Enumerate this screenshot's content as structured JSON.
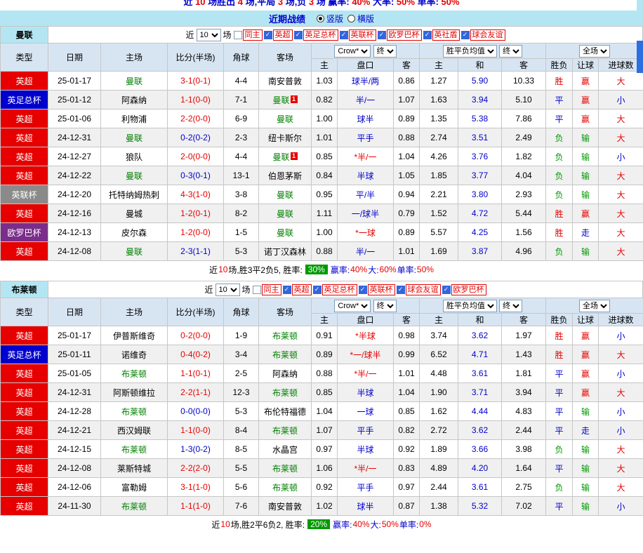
{
  "top_bar": {
    "segments": [
      {
        "t": "近 ",
        "c": "blue"
      },
      {
        "t": "10",
        "c": "red"
      },
      {
        "t": " 场胜出 ",
        "c": "blue"
      },
      {
        "t": "4",
        "c": "red"
      },
      {
        "t": " 场,平局 ",
        "c": "blue"
      },
      {
        "t": "3",
        "c": "red"
      },
      {
        "t": " 场,负 ",
        "c": "blue"
      },
      {
        "t": "3",
        "c": "red"
      },
      {
        "t": " 场 赢率: ",
        "c": "blue"
      },
      {
        "t": "40%",
        "c": "red"
      },
      {
        "t": " 大率: ",
        "c": "blue"
      },
      {
        "t": "50%",
        "c": "red"
      },
      {
        "t": " 单率: ",
        "c": "blue"
      },
      {
        "t": "50%",
        "c": "red"
      }
    ]
  },
  "title_bar": {
    "title": "近期战绩",
    "radios": [
      {
        "label": "竖版",
        "selected": true
      },
      {
        "label": "横版",
        "selected": false
      }
    ]
  },
  "colors": {
    "red": "#e60000",
    "blue": "#0000cc",
    "green": "#009900",
    "team_green": "#008000",
    "type_bg": {
      "英超": "#e60000",
      "英足总杯": "#0000cc",
      "英联杯": "#8a8a8a",
      "欧罗巴杯": "#7b2d8b"
    },
    "result": {
      "胜": "#e60000",
      "平": "#0000cc",
      "负": "#009900"
    },
    "hresult": {
      "赢": "#e60000",
      "输": "#009900",
      "走": "#0000cc"
    },
    "goals": {
      "大": "#e60000",
      "小": "#0000cc"
    }
  },
  "shared": {
    "filters": {
      "near_label": "近",
      "matches_label": "场"
    },
    "selects": {
      "recent": "10",
      "provider": "Crow*",
      "stage1": "终",
      "wdl": "胜平负均值",
      "stage2": "终",
      "scope": "全场"
    },
    "columns": {
      "type": "类型",
      "date": "日期",
      "home": "主场",
      "score": "比分(半场)",
      "corner": "角球",
      "away": "客场",
      "ah_home": "主",
      "handicap": "盘口",
      "ah_away": "客",
      "o_home": "主",
      "o_draw": "和",
      "o_away": "客",
      "wdl": "胜负",
      "hcp_res": "让球",
      "goals": "进球数"
    }
  },
  "sections": [
    {
      "team": "曼联",
      "filters": {
        "recent_value": "10",
        "checkboxes": [
          {
            "label": "同主",
            "checked": false
          },
          {
            "label": "英超",
            "checked": true
          },
          {
            "label": "英足总杯",
            "checked": true
          },
          {
            "label": "英联杯",
            "checked": true
          },
          {
            "label": "欧罗巴杯",
            "checked": true
          },
          {
            "label": "英社盾",
            "checked": true
          },
          {
            "label": "球会友谊",
            "checked": true
          }
        ]
      },
      "rows": [
        {
          "type": "英超",
          "date": "25-01-17",
          "home": "曼联",
          "hs": 1,
          "hrc": 0,
          "score": "3-1(0-1)",
          "sc": "red",
          "corner": "4-4",
          "away": "南安普敦",
          "as": 0,
          "arc": 0,
          "ah": [
            "1.03",
            "球半/两",
            "0.86"
          ],
          "odds": [
            "1.27",
            "5.90",
            "10.33"
          ],
          "res": [
            "胜",
            "赢",
            "大"
          ]
        },
        {
          "type": "英足总杯",
          "date": "25-01-12",
          "home": "阿森纳",
          "hs": 0,
          "hrc": 0,
          "score": "1-1(0-0)",
          "sc": "red",
          "corner": "7-1",
          "away": "曼联",
          "as": 1,
          "arc": 1,
          "ah": [
            "0.82",
            "半/一",
            "1.07"
          ],
          "odds": [
            "1.63",
            "3.94",
            "5.10"
          ],
          "res": [
            "平",
            "赢",
            "小"
          ]
        },
        {
          "type": "英超",
          "date": "25-01-06",
          "home": "利物浦",
          "hs": 0,
          "hrc": 0,
          "score": "2-2(0-0)",
          "sc": "red",
          "corner": "6-9",
          "away": "曼联",
          "as": 1,
          "arc": 0,
          "ah": [
            "1.00",
            "球半",
            "0.89"
          ],
          "odds": [
            "1.35",
            "5.38",
            "7.86"
          ],
          "res": [
            "平",
            "赢",
            "大"
          ]
        },
        {
          "type": "英超",
          "date": "24-12-31",
          "home": "曼联",
          "hs": 1,
          "hrc": 0,
          "score": "0-2(0-2)",
          "sc": "blue",
          "corner": "2-3",
          "away": "纽卡斯尔",
          "as": 0,
          "arc": 0,
          "ah": [
            "1.01",
            "平手",
            "0.88"
          ],
          "odds": [
            "2.74",
            "3.51",
            "2.49"
          ],
          "res": [
            "负",
            "输",
            "大"
          ]
        },
        {
          "type": "英超",
          "date": "24-12-27",
          "home": "狼队",
          "hs": 0,
          "hrc": 0,
          "score": "2-0(0-0)",
          "sc": "red",
          "corner": "4-4",
          "away": "曼联",
          "as": 1,
          "arc": 1,
          "ah": [
            "0.85",
            "*半/一",
            "1.04"
          ],
          "odds": [
            "4.26",
            "3.76",
            "1.82"
          ],
          "res": [
            "负",
            "输",
            "小"
          ]
        },
        {
          "type": "英超",
          "date": "24-12-22",
          "home": "曼联",
          "hs": 1,
          "hrc": 0,
          "score": "0-3(0-1)",
          "sc": "blue",
          "corner": "13-1",
          "away": "伯恩茅斯",
          "as": 0,
          "arc": 0,
          "ah": [
            "0.84",
            "半球",
            "1.05"
          ],
          "odds": [
            "1.85",
            "3.77",
            "4.04"
          ],
          "res": [
            "负",
            "输",
            "大"
          ]
        },
        {
          "type": "英联杯",
          "date": "24-12-20",
          "home": "托特纳姆热刺",
          "hs": 0,
          "hrc": 0,
          "score": "4-3(1-0)",
          "sc": "red",
          "corner": "3-8",
          "away": "曼联",
          "as": 1,
          "arc": 0,
          "ah": [
            "0.95",
            "平/半",
            "0.94"
          ],
          "odds": [
            "2.21",
            "3.80",
            "2.93"
          ],
          "res": [
            "负",
            "输",
            "大"
          ]
        },
        {
          "type": "英超",
          "date": "24-12-16",
          "home": "曼城",
          "hs": 0,
          "hrc": 0,
          "score": "1-2(0-1)",
          "sc": "red",
          "corner": "8-2",
          "away": "曼联",
          "as": 1,
          "arc": 0,
          "ah": [
            "1.11",
            "一/球半",
            "0.79"
          ],
          "odds": [
            "1.52",
            "4.72",
            "5.44"
          ],
          "res": [
            "胜",
            "赢",
            "大"
          ]
        },
        {
          "type": "欧罗巴杯",
          "date": "24-12-13",
          "home": "皮尔森",
          "hs": 0,
          "hrc": 0,
          "score": "1-2(0-0)",
          "sc": "red",
          "corner": "1-5",
          "away": "曼联",
          "as": 1,
          "arc": 0,
          "ah": [
            "1.00",
            "*一球",
            "0.89"
          ],
          "odds": [
            "5.57",
            "4.25",
            "1.56"
          ],
          "res": [
            "胜",
            "走",
            "大"
          ]
        },
        {
          "type": "英超",
          "date": "24-12-08",
          "home": "曼联",
          "hs": 1,
          "hrc": 0,
          "score": "2-3(1-1)",
          "sc": "blue",
          "corner": "5-3",
          "away": "诺丁汉森林",
          "as": 0,
          "arc": 0,
          "ah": [
            "0.88",
            "半/一",
            "1.01"
          ],
          "odds": [
            "1.69",
            "3.87",
            "4.96"
          ],
          "res": [
            "负",
            "输",
            "大"
          ]
        }
      ],
      "footer": {
        "segments": [
          {
            "t": "近",
            "c": "black"
          },
          {
            "t": "10",
            "c": "red"
          },
          {
            "t": "场,胜3平2负5, 胜率: ",
            "c": "black"
          },
          {
            "t": "30%",
            "badge": true
          },
          {
            "t": " 赢率:",
            "c": "blue"
          },
          {
            "t": "40%",
            "c": "red"
          },
          {
            "t": " 大:",
            "c": "blue"
          },
          {
            "t": "60%",
            "c": "red"
          },
          {
            "t": " 单率:",
            "c": "blue"
          },
          {
            "t": "50%",
            "c": "red"
          }
        ]
      }
    },
    {
      "team": "布莱顿",
      "filters": {
        "recent_value": "10",
        "checkboxes": [
          {
            "label": "同主",
            "checked": false
          },
          {
            "label": "英超",
            "checked": true
          },
          {
            "label": "英足总杯",
            "checked": true
          },
          {
            "label": "英联杯",
            "checked": true
          },
          {
            "label": "球会友谊",
            "checked": true
          },
          {
            "label": "欧罗巴杯",
            "checked": true
          }
        ]
      },
      "rows": [
        {
          "type": "英超",
          "date": "25-01-17",
          "home": "伊普斯维奇",
          "hs": 0,
          "hrc": 0,
          "score": "0-2(0-0)",
          "sc": "red",
          "corner": "1-9",
          "away": "布莱顿",
          "as": 1,
          "arc": 0,
          "ah": [
            "0.91",
            "*半球",
            "0.98"
          ],
          "odds": [
            "3.74",
            "3.62",
            "1.97"
          ],
          "res": [
            "胜",
            "赢",
            "小"
          ]
        },
        {
          "type": "英足总杯",
          "date": "25-01-11",
          "home": "诺维奇",
          "hs": 0,
          "hrc": 0,
          "score": "0-4(0-2)",
          "sc": "red",
          "corner": "3-4",
          "away": "布莱顿",
          "as": 1,
          "arc": 0,
          "ah": [
            "0.89",
            "*一/球半",
            "0.99"
          ],
          "odds": [
            "6.52",
            "4.71",
            "1.43"
          ],
          "res": [
            "胜",
            "赢",
            "大"
          ]
        },
        {
          "type": "英超",
          "date": "25-01-05",
          "home": "布莱顿",
          "hs": 1,
          "hrc": 0,
          "score": "1-1(0-1)",
          "sc": "red",
          "corner": "2-5",
          "away": "阿森纳",
          "as": 0,
          "arc": 0,
          "ah": [
            "0.88",
            "*半/一",
            "1.01"
          ],
          "odds": [
            "4.48",
            "3.61",
            "1.81"
          ],
          "res": [
            "平",
            "赢",
            "小"
          ]
        },
        {
          "type": "英超",
          "date": "24-12-31",
          "home": "阿斯顿维拉",
          "hs": 0,
          "hrc": 0,
          "score": "2-2(1-1)",
          "sc": "red",
          "corner": "12-3",
          "away": "布莱顿",
          "as": 1,
          "arc": 0,
          "ah": [
            "0.85",
            "半球",
            "1.04"
          ],
          "odds": [
            "1.90",
            "3.71",
            "3.94"
          ],
          "res": [
            "平",
            "赢",
            "大"
          ]
        },
        {
          "type": "英超",
          "date": "24-12-28",
          "home": "布莱顿",
          "hs": 1,
          "hrc": 0,
          "score": "0-0(0-0)",
          "sc": "blue",
          "corner": "5-3",
          "away": "布伦特福德",
          "as": 0,
          "arc": 0,
          "ah": [
            "1.04",
            "一球",
            "0.85"
          ],
          "odds": [
            "1.62",
            "4.44",
            "4.83"
          ],
          "res": [
            "平",
            "输",
            "小"
          ]
        },
        {
          "type": "英超",
          "date": "24-12-21",
          "home": "西汉姆联",
          "hs": 0,
          "hrc": 0,
          "score": "1-1(0-0)",
          "sc": "red",
          "corner": "8-4",
          "away": "布莱顿",
          "as": 1,
          "arc": 0,
          "ah": [
            "1.07",
            "平手",
            "0.82"
          ],
          "odds": [
            "2.72",
            "3.62",
            "2.44"
          ],
          "res": [
            "平",
            "走",
            "小"
          ]
        },
        {
          "type": "英超",
          "date": "24-12-15",
          "home": "布莱顿",
          "hs": 1,
          "hrc": 0,
          "score": "1-3(0-2)",
          "sc": "blue",
          "corner": "8-5",
          "away": "水晶宫",
          "as": 0,
          "arc": 0,
          "ah": [
            "0.97",
            "半球",
            "0.92"
          ],
          "odds": [
            "1.89",
            "3.66",
            "3.98"
          ],
          "res": [
            "负",
            "输",
            "大"
          ]
        },
        {
          "type": "英超",
          "date": "24-12-08",
          "home": "莱斯特城",
          "hs": 0,
          "hrc": 0,
          "score": "2-2(2-0)",
          "sc": "red",
          "corner": "5-5",
          "away": "布莱顿",
          "as": 1,
          "arc": 0,
          "ah": [
            "1.06",
            "*半/一",
            "0.83"
          ],
          "odds": [
            "4.89",
            "4.20",
            "1.64"
          ],
          "res": [
            "平",
            "输",
            "大"
          ]
        },
        {
          "type": "英超",
          "date": "24-12-06",
          "home": "富勒姆",
          "hs": 0,
          "hrc": 0,
          "score": "3-1(1-0)",
          "sc": "red",
          "corner": "5-6",
          "away": "布莱顿",
          "as": 1,
          "arc": 0,
          "ah": [
            "0.92",
            "平手",
            "0.97"
          ],
          "odds": [
            "2.44",
            "3.61",
            "2.75"
          ],
          "res": [
            "负",
            "输",
            "大"
          ]
        },
        {
          "type": "英超",
          "date": "24-11-30",
          "home": "布莱顿",
          "hs": 1,
          "hrc": 0,
          "score": "1-1(1-0)",
          "sc": "red",
          "corner": "7-6",
          "away": "南安普敦",
          "as": 0,
          "arc": 0,
          "ah": [
            "1.02",
            "球半",
            "0.87"
          ],
          "odds": [
            "1.38",
            "5.32",
            "7.02"
          ],
          "res": [
            "平",
            "输",
            "小"
          ]
        }
      ],
      "footer": {
        "segments": [
          {
            "t": "近",
            "c": "black"
          },
          {
            "t": "10",
            "c": "red"
          },
          {
            "t": "场,胜2平6负2, 胜率: ",
            "c": "black"
          },
          {
            "t": "20%",
            "badge": true
          },
          {
            "t": " 赢率:",
            "c": "blue"
          },
          {
            "t": "40%",
            "c": "red"
          },
          {
            "t": " 大:",
            "c": "blue"
          },
          {
            "t": "50%",
            "c": "red"
          },
          {
            "t": " 单率:",
            "c": "blue"
          },
          {
            "t": "0%",
            "c": "red"
          }
        ]
      }
    }
  ]
}
